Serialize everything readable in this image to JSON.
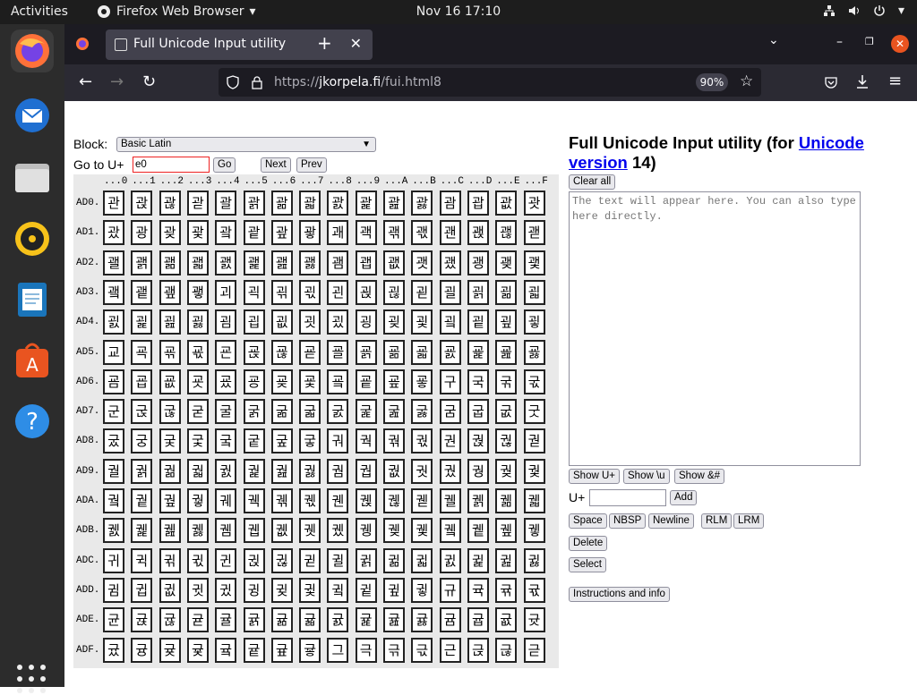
{
  "topbar": {
    "activities": "Activities",
    "app_name": "Firefox Web Browser",
    "clock": "Nov 16  17:10"
  },
  "browser": {
    "tab_title": "Full Unicode Input utility",
    "url_prefix": "https://",
    "url_host": "jkorpela.fi",
    "url_path": "/fui.html8",
    "zoom": "90%"
  },
  "page": {
    "block_label": "Block:",
    "block_value": "Basic Latin",
    "goto_label": "Go to U+",
    "goto_value": "e0",
    "go_btn": "Go",
    "next_btn": "Next",
    "prev_btn": "Prev",
    "col_headers": [
      "...0",
      "...1",
      "...2",
      "...3",
      "...4",
      "...5",
      "...6",
      "...7",
      "...8",
      "...9",
      "...A",
      "...B",
      "...C",
      "...D",
      "...E",
      "...F"
    ],
    "rows": [
      {
        "h": "AD0.",
        "c": "관괁괂괃괄괅괆괇괈괉괊괋괌괍괎괏"
      },
      {
        "h": "AD1.",
        "c": "괐광괒괓괔괕괖괗괘괙괚괛괜괝괞괟"
      },
      {
        "h": "AD2.",
        "c": "괠괡괢괣괤괥괦괧괨괩괪괫괬괭괮괯"
      },
      {
        "h": "AD3.",
        "c": "괰괱괲괳괴괵괶괷괸괹괺괻괼괽괾괿"
      },
      {
        "h": "AD4.",
        "c": "굀굁굂굃굄굅굆굇굈굉굊굋굌굍굎굏"
      },
      {
        "h": "AD5.",
        "c": "교굑굒굓굔굕굖굗굘굙굚굛굜굝굞굟"
      },
      {
        "h": "AD6.",
        "c": "굠굡굢굣굤굥굦굧굨굩굪굫구국굮굯"
      },
      {
        "h": "AD7.",
        "c": "군굱굲굳굴굵굶굷굸굹굺굻굼굽굾굿"
      },
      {
        "h": "AD8.",
        "c": "궀궁궂궃궄궅궆궇궈궉궊궋권궍궎궏"
      },
      {
        "h": "AD9.",
        "c": "궐궑궒궓궔궕궖궗궘궙궚궛궜궝궞궟"
      },
      {
        "h": "ADA.",
        "c": "궠궡궢궣궤궥궦궧궨궩궪궫궬궭궮궯"
      },
      {
        "h": "ADB.",
        "c": "궰궱궲궳궴궵궶궷궸궹궺궻궼궽궾궿"
      },
      {
        "h": "ADC.",
        "c": "귀귁귂귃귄귅귆귇귈귉귊귋귌귍귎귏"
      },
      {
        "h": "ADD.",
        "c": "귐귑귒귓귔귕귖귗귘귙귚귛규귝귞귟"
      },
      {
        "h": "ADE.",
        "c": "균귡귢귣귤귥귦귧귨귩귪귫귬귭귮귯"
      },
      {
        "h": "ADF.",
        "c": "귰귱귲귳귴귵귶귷그극귺귻근귽귾귿"
      }
    ],
    "title_pre": "Full Unicode Input utility (for ",
    "title_link": "Unicode version",
    "title_post": " 14)",
    "clear_all": "Clear all",
    "placeholder": "The text will appear here. You can also type here directly.",
    "show_uplus": "Show U+",
    "show_u": "Show \\u",
    "show_amp": "Show &#",
    "uplus_label": "U+",
    "add_btn": "Add",
    "space": "Space",
    "nbsp": "NBSP",
    "newline": "Newline",
    "rlm": "RLM",
    "lrm": "LRM",
    "delete": "Delete",
    "select": "Select",
    "instructions": "Instructions and info"
  }
}
